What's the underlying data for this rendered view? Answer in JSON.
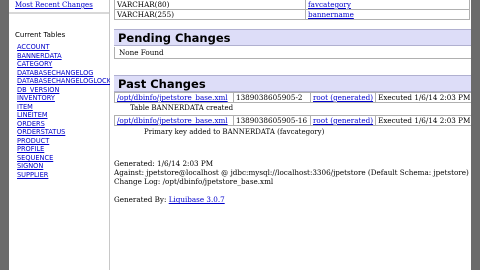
{
  "nav": {
    "top_link": "Most Recent Changes",
    "section_title": "Current Tables",
    "tables": [
      "ACCOUNT",
      "BANNERDATA",
      "CATEGORY",
      "DATABASECHANGELOG",
      "DATABASECHANGELOGLOCK",
      "DB_VERSION",
      "INVENTORY",
      "ITEM",
      "LINEITEM",
      "ORDERS",
      "ORDERSTATUS",
      "PRODUCT",
      "PROFILE",
      "SEQUENCE",
      "SIGNON",
      "SUPPLIER"
    ]
  },
  "columns_table": {
    "rows": [
      {
        "type": "VARCHAR(80)",
        "name": "favcategory"
      },
      {
        "type": "VARCHAR(255)",
        "name": "bannername"
      }
    ]
  },
  "pending": {
    "title": "Pending Changes",
    "message": "None Found"
  },
  "past": {
    "title": "Past Changes",
    "rows": [
      {
        "file": "/opt/dbinfo/jpetstore_base.xml",
        "id": "1389038605905-2",
        "author": "root (generated)",
        "executed": "Executed 1/6/14 2:03 PM",
        "note": "Table BANNERDATA created"
      },
      {
        "file": "/opt/dbinfo/jpetstore_base.xml",
        "id": "1389038605905-16",
        "author": "root (generated)",
        "executed": "Executed 1/6/14 2:03 PM",
        "note": "Primary key added to BANNERDATA (favcategory)"
      }
    ]
  },
  "footer": {
    "generated": "Generated: 1/6/14 2:03 PM",
    "against": "Against: jpetstore@localhost @ jdbc:mysql://localhost:3306/jpetstore (Default Schema: jpetstore)",
    "changelog": "Change Log: /opt/dbinfo/jpetstore_base.xml",
    "generated_by_prefix": "Generated By: ",
    "generated_by_link": "Liquibase 3.0.7"
  }
}
